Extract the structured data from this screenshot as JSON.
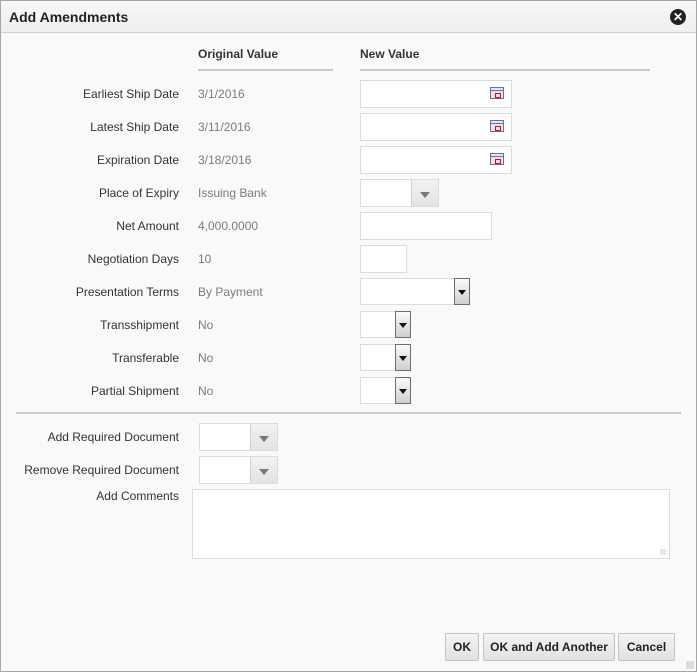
{
  "dialog": {
    "title": "Add Amendments",
    "close_icon": "close-circle-icon"
  },
  "columns": {
    "original": "Original Value",
    "new": "New Value"
  },
  "rows": [
    {
      "label": "Earliest Ship Date",
      "original": "3/1/2016",
      "control": "date",
      "value": ""
    },
    {
      "label": "Latest Ship Date",
      "original": "3/11/2016",
      "control": "date",
      "value": ""
    },
    {
      "label": "Expiration Date",
      "original": "3/18/2016",
      "control": "date",
      "value": ""
    },
    {
      "label": "Place of Expiry",
      "original": "Issuing Bank",
      "control": "combobox",
      "value": ""
    },
    {
      "label": "Net Amount",
      "original": "4,000.0000",
      "control": "text",
      "value": ""
    },
    {
      "label": "Negotiation Days",
      "original": "10",
      "control": "text",
      "value": ""
    },
    {
      "label": "Presentation Terms",
      "original": "By Payment",
      "control": "select",
      "value": ""
    },
    {
      "label": "Transshipment",
      "original": "No",
      "control": "select",
      "value": ""
    },
    {
      "label": "Transferable",
      "original": "No",
      "control": "select",
      "value": ""
    },
    {
      "label": "Partial Shipment",
      "original": "No",
      "control": "select",
      "value": ""
    }
  ],
  "documents": {
    "add_label": "Add Required Document",
    "add_value": "",
    "remove_label": "Remove Required Document",
    "remove_value": "",
    "comments_label": "Add Comments",
    "comments_value": ""
  },
  "buttons": {
    "ok": "OK",
    "ok_add_another": "OK and Add Another",
    "cancel": "Cancel"
  }
}
